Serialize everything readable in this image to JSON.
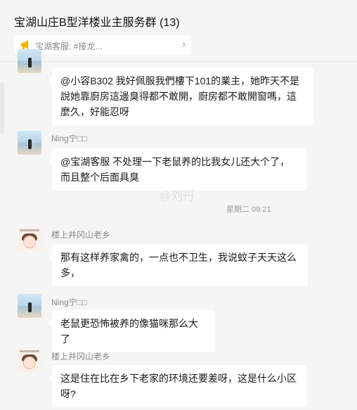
{
  "header": {
    "title": "宝湖山庄B型洋楼业主服务群 (13)",
    "notice_text": "宝湖客服: #接龙...",
    "notice_icon": "megaphone-icon"
  },
  "watermark": "@刘丹",
  "timestamp": "星期二 09:21",
  "messages": [
    {
      "sender": "",
      "text": "@小容B302 我好佩服我們樓下101的業主，她昨天不是說她靠廚房這邊臭得都不敢開，廚房都不敢開窗嗎，這麼久，好能忍呀",
      "avatar": "beach-avatar"
    },
    {
      "sender": "Ning宁□□",
      "text": "@宝湖客服 不处理一下老鼠养的比我女儿还大个了，而且整个后面具臭",
      "avatar": "beach-avatar"
    },
    {
      "sender": "楼上井冈山老乡",
      "text": "那有这样养家禽的，一点也不卫生，我说蚊子天天这么多，",
      "avatar": "girl-avatar"
    },
    {
      "sender": "Ning宁□□",
      "text": "老鼠更恐怖被养的像猫咪那么大了",
      "avatar": "beach-avatar"
    },
    {
      "sender": "楼上井冈山老乡",
      "text": "这是住在比在乡下老家的环境还要差呀，这是什么小区呀?",
      "avatar": "girl-avatar"
    }
  ]
}
